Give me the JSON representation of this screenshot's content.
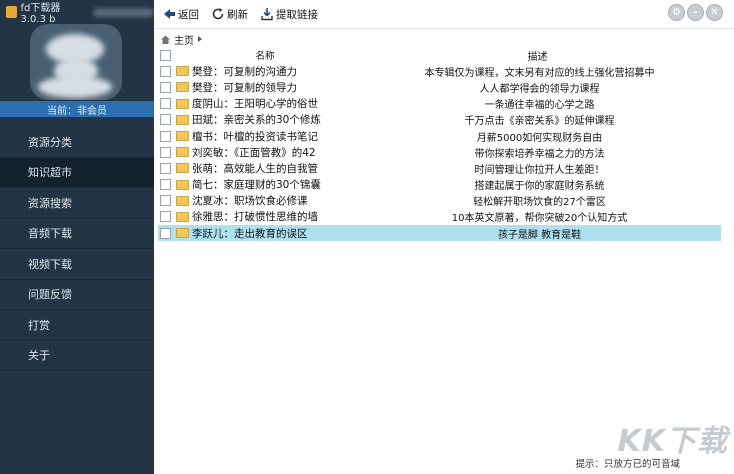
{
  "app": {
    "title": "fd下载器 3.0.3 b"
  },
  "sidebar": {
    "member_status": "当前：非会员",
    "items": [
      {
        "label": "资源分类"
      },
      {
        "label": "知识超市"
      },
      {
        "label": "资源搜索"
      },
      {
        "label": "音频下载"
      },
      {
        "label": "视频下载"
      },
      {
        "label": "问题反馈"
      },
      {
        "label": "打赏"
      },
      {
        "label": "关于"
      }
    ],
    "active_index": 1
  },
  "toolbar": {
    "back_label": "返回",
    "refresh_label": "刷新",
    "extract_label": "提取链接"
  },
  "breadcrumb": {
    "home": "主页"
  },
  "table": {
    "columns": {
      "name": "名称",
      "desc": "描述"
    },
    "rows": [
      {
        "name": "樊登：可复制的沟通力",
        "desc": "本专辑仅为课程，文末另有对应的线上强化营招募中"
      },
      {
        "name": "樊登：可复制的领导力",
        "desc": "人人都学得会的领导力课程"
      },
      {
        "name": "度阴山：王阳明心学的俗世",
        "desc": "一条通往幸福的心学之路"
      },
      {
        "name": "田斌：亲密关系的30个修炼",
        "desc": "千万点击《亲密关系》的延伸课程"
      },
      {
        "name": "檀书：叶檀的投资读书笔记",
        "desc": "月薪5000如何实现财务自由"
      },
      {
        "name": "刘奕敏：《正面管教》的42",
        "desc": "带你探索培养幸福之力的方法"
      },
      {
        "name": "张萌：高效能人生的自我管",
        "desc": "时间管理让你拉开人生差距！"
      },
      {
        "name": "简七：家庭理财的30个锦囊",
        "desc": "搭建起属于你的家庭财务系统"
      },
      {
        "name": "沈夏冰：职场饮食必修课",
        "desc": "轻松解开职场饮食的27个雷区"
      },
      {
        "name": "徐雅思：打破惯性思维的墙",
        "desc": "10本英文原著，帮你突破20个认知方式"
      },
      {
        "name": "李跃儿：走出教育的误区",
        "desc": "孩子是脚 教育是鞋"
      }
    ],
    "selected_index": 10
  },
  "footer": {
    "hint": "提示：只放方已的可音域"
  },
  "watermark": "KK下载",
  "colors": {
    "sidebar_bg": "#233544",
    "member_bar": "#2b6fae",
    "selected_row": "#aee0f0"
  }
}
